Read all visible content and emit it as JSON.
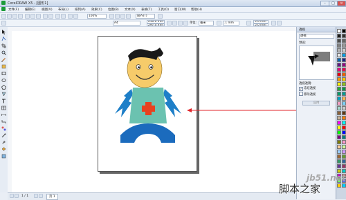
{
  "window": {
    "title": "CorelDRAW X5 - [图形1]",
    "controls": [
      "–",
      "□",
      "×"
    ]
  },
  "menu": [
    "文件(F)",
    "编辑(E)",
    "视图(V)",
    "布局(L)",
    "排列(A)",
    "效果(C)",
    "位图(B)",
    "文本(X)",
    "表格(T)",
    "工具(O)",
    "窗口(W)",
    "帮助(H)"
  ],
  "toolbar_standard": {
    "zoom": "100%",
    "snap": "贴齐(T)"
  },
  "property_bar": {
    "paper": "A4",
    "width": "210.0 mm",
    "height": "297.0 mm",
    "units_label": "单位:",
    "units": "毫米",
    "nudge": ".1 mm",
    "dup_x": "5.0 mm",
    "dup_y": "5.0 mm"
  },
  "page_nav": {
    "count": "1 / 1",
    "tab": "页 1"
  },
  "docker": {
    "title": "透视",
    "select": "透视",
    "preview_label": "预览:",
    "section_label": "透视透镜:",
    "options": [
      {
        "label": "冻结透视",
        "checked": true
      },
      {
        "label": "移除透视",
        "checked": false
      }
    ],
    "apply": "应用"
  },
  "palette_colors": [
    "#ffffff",
    "#000000",
    "#1a1a1a",
    "#333333",
    "#4d4d4d",
    "#666666",
    "#808080",
    "#999999",
    "#b3b3b3",
    "#cccccc",
    "#e6e6e6",
    "#00a0e9",
    "#0068b7",
    "#1d2088",
    "#601986",
    "#920783",
    "#e4007f",
    "#e5004f",
    "#e60012",
    "#eb6100",
    "#f39800",
    "#fcc800",
    "#fff100",
    "#8fc31f",
    "#22ac38",
    "#009944",
    "#009b6b",
    "#009e96",
    "#00a0c1",
    "#f8b551",
    "#f19ec2",
    "#7ecef4",
    "#a3d6cc",
    "#c9caca",
    "#8c6239",
    "#603813",
    "#c7b299",
    "#ff7f00",
    "#ff00ff",
    "#00ffff",
    "#ffff00",
    "#ff0000",
    "#00ff00",
    "#0000ff",
    "#7f007f",
    "#007f7f",
    "#7f7f00",
    "#ff99cc",
    "#ffcc99",
    "#ccff99",
    "#99ccff",
    "#cc99ff",
    "#996633",
    "#669933",
    "#339966",
    "#336699",
    "#663399",
    "#993366",
    "#cccc00",
    "#00cccc",
    "#cc00cc",
    "#ff6666",
    "#66ff66",
    "#6666ff",
    "#ffcc00",
    "#00ccff"
  ],
  "watermark": {
    "url": "jb51.net",
    "brand": "脚本之家"
  },
  "colors": {
    "face": "#f6cb6a",
    "hair": "#1a1a1a",
    "body": "#6bc2b0",
    "cross": "#e8411f",
    "arms": "#1e7fc8",
    "legs": "#1b6bbd",
    "arrow": "#e0262b"
  }
}
